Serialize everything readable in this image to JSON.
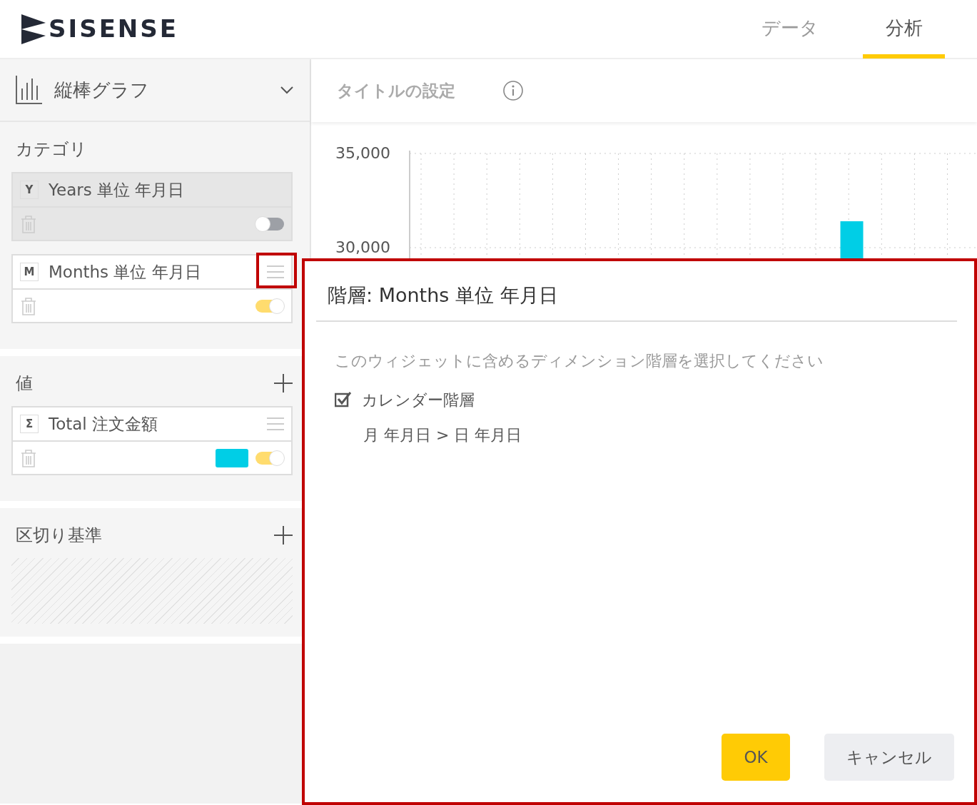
{
  "header": {
    "logo": "SISENSE",
    "tabs": [
      {
        "label": "データ",
        "selected": false
      },
      {
        "label": "分析",
        "selected": true
      }
    ]
  },
  "sidebar": {
    "chart_type": "縦棒グラフ",
    "sections": [
      {
        "title": "カテゴリ",
        "add": false,
        "items": [
          {
            "badge": "Y",
            "label": "Years 単位 年月日",
            "on": false,
            "highlighted": false
          },
          {
            "badge": "M",
            "label": "Months 単位 年月日",
            "on": true,
            "highlighted": true
          }
        ]
      },
      {
        "title": "値",
        "add": true,
        "items": [
          {
            "badge": "Σ",
            "label": "Total 注文金額",
            "on": true,
            "highlighted": false,
            "color": "#00cee6"
          }
        ]
      },
      {
        "title": "区切り基準",
        "add": true
      }
    ]
  },
  "widget": {
    "title_placeholder": "タイトルの設定",
    "chart_data": {
      "type": "bar",
      "ylim": [
        30000,
        35000
      ],
      "yticks": [
        {
          "value": 35000,
          "label": "35,000"
        },
        {
          "value": 30000,
          "label": "30,000"
        }
      ],
      "values": [
        null,
        null,
        null,
        null,
        null,
        null,
        null,
        null,
        null,
        null,
        null,
        null,
        31400,
        null,
        null,
        null
      ]
    }
  },
  "dialog": {
    "title": "階層: Months 単位 年月日",
    "hint": "このウィジェットに含めるディメンション階層を選択してください",
    "options": [
      {
        "label": "カレンダー階層",
        "checked": true,
        "path": "月 年月日 > 日 年月日"
      }
    ],
    "buttons": [
      {
        "label": "OK",
        "kind": "primary"
      },
      {
        "label": "キャンセル",
        "kind": "secondary"
      }
    ]
  }
}
